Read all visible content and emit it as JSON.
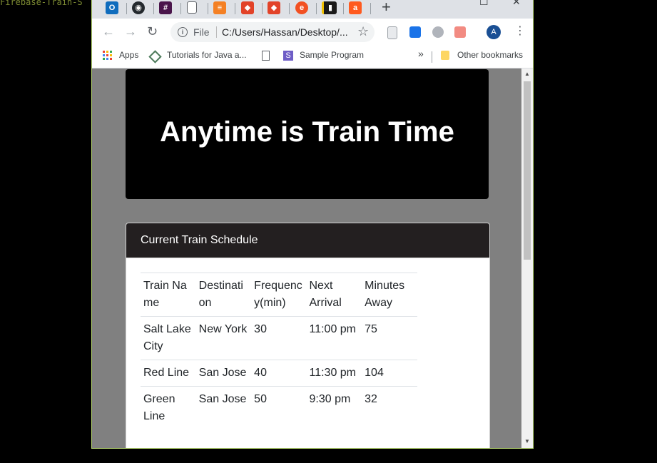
{
  "terminal": {
    "text": "Firebase-Train-S"
  },
  "browser": {
    "tab_icons": [
      {
        "name": "outlook-icon",
        "color": "#0f6cbd",
        "glyph": "O"
      },
      {
        "name": "github-icon",
        "color": "#24292e",
        "glyph": "◉"
      },
      {
        "name": "slack-icon",
        "color": "#4a154b",
        "glyph": "#"
      },
      {
        "name": "page-icon",
        "color": "#ffffff",
        "glyph": ""
      },
      {
        "name": "stackoverflow-icon",
        "color": "#f48024",
        "glyph": "≡"
      },
      {
        "name": "gitlab-icon",
        "color": "#e24329",
        "glyph": "◆"
      },
      {
        "name": "gitlab-icon-2",
        "color": "#e24329",
        "glyph": "◆"
      },
      {
        "name": "edge-icon",
        "color": "#f25022",
        "glyph": "e"
      },
      {
        "name": "app-icon",
        "color": "#1a1a1a",
        "glyph": "▮"
      },
      {
        "name": "a-icon",
        "color": "#ff5a1f",
        "glyph": "a"
      }
    ],
    "new_tab": "+",
    "window_controls": {
      "maximize": "☐",
      "close": "✕"
    },
    "toolbar": {
      "back": "←",
      "forward": "→",
      "reload": "↻",
      "scheme": "File",
      "url": "C:/Users/Hassan/Desktop/...",
      "star": "☆",
      "avatar": "A",
      "menu": "⋮"
    },
    "bookmarks": {
      "apps": "Apps",
      "tutorials": "Tutorials for Java a...",
      "sample": "Sample Program",
      "overflow": "»",
      "other": "Other bookmarks"
    }
  },
  "page": {
    "title": "Anytime is Train Time",
    "card_header": "Current Train Schedule",
    "table": {
      "headers": [
        "Train Name",
        "Destination",
        "Frequency(min)",
        "Next Arrival",
        "Minutes Away"
      ],
      "rows": [
        [
          "Salt Lake City",
          "New York",
          "30",
          "11:00 pm",
          "75"
        ],
        [
          "Red Line",
          "San Jose",
          "40",
          "11:30 pm",
          "104"
        ],
        [
          "Green Line",
          "San Jose",
          "50",
          "9:30 pm",
          "32"
        ]
      ]
    }
  }
}
